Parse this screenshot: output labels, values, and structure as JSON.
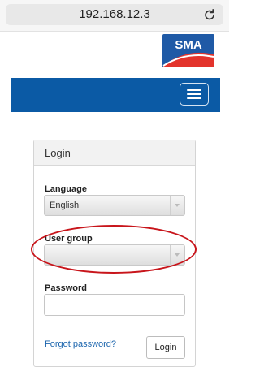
{
  "browser": {
    "url": "192.168.12.3",
    "reload_icon": "reload-icon"
  },
  "header": {
    "logo_text": "SMA",
    "logo_colors": {
      "background": "#1f5aa6",
      "arc": "#e3342c"
    }
  },
  "navbar": {
    "color": "#0b5aa5",
    "menu_icon": "hamburger-menu-icon"
  },
  "login": {
    "title": "Login",
    "language_label": "Language",
    "language_value": "English",
    "user_group_label": "User group",
    "user_group_value": "",
    "password_label": "Password",
    "password_value": "",
    "forgot_password": "Forgot password?",
    "login_button": "Login"
  },
  "annotation": {
    "color": "#c8151b",
    "target": "User group"
  }
}
